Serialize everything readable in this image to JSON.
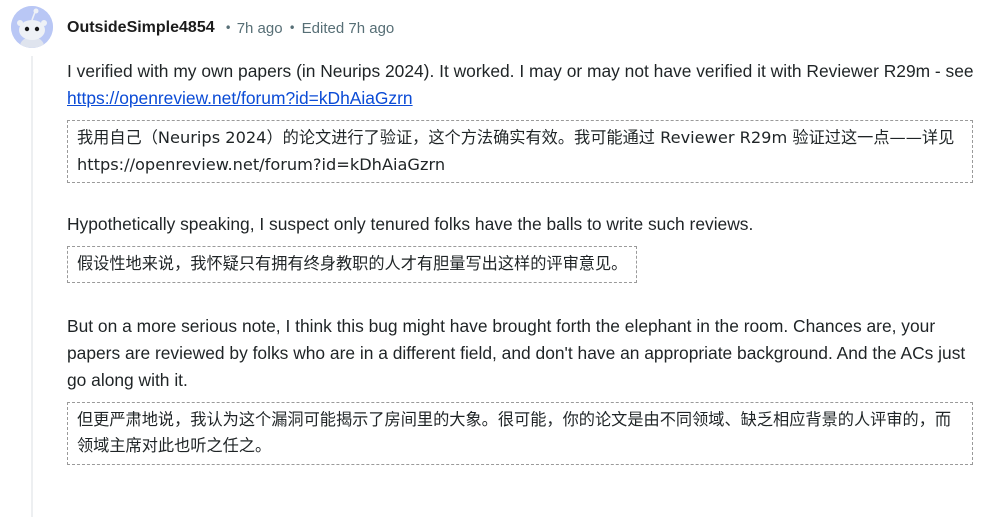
{
  "comment": {
    "username": "OutsideSimple4854",
    "time": "7h ago",
    "edited": "Edited 7h ago",
    "blocks": [
      {
        "text_before": "I verified with my own papers (in Neurips 2024). It worked. I may or may not have verified it with Reviewer R29m - see ",
        "link": "https://openreview.net/forum?id=kDhAiaGzrn",
        "translation": "我用自己（Neurips 2024）的论文进行了验证，这个方法确实有效。我可能通过 Reviewer R29m 验证过这一点——详见 https://openreview.net/forum?id=kDhAiaGzrn"
      },
      {
        "text": "Hypothetically speaking, I suspect only tenured folks have the balls to write such reviews.",
        "translation": "假设性地来说，我怀疑只有拥有终身教职的人才有胆量写出这样的评审意见。"
      },
      {
        "text": "But on a more serious note, I think this bug might have brought forth the elephant in the room. Chances are, your papers are reviewed by folks who are in a different field, and don't have an appropriate background. And the ACs just go along with it.",
        "translation": "但更严肃地说，我认为这个漏洞可能揭示了房间里的大象。很可能，你的论文是由不同领域、缺乏相应背景的人评审的，而领域主席对此也听之任之。"
      }
    ]
  },
  "colors": {
    "avatar_bg": "#b9c7f5",
    "link": "#0b4bd6",
    "meta": "#576f76"
  }
}
